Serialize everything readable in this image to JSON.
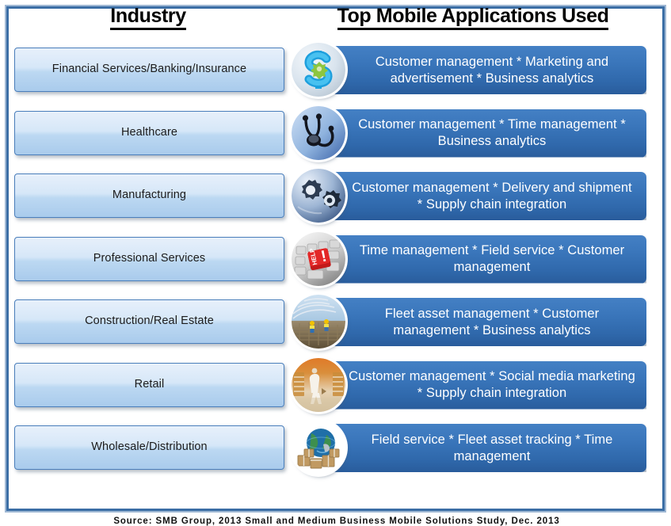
{
  "headers": {
    "industry": "Industry",
    "applications": "Top Mobile Applications Used"
  },
  "colors": {
    "frame_border": "#3b6ea5",
    "frame_outer": "#9fb8d4",
    "banner_top": "#4480c4",
    "banner_bottom": "#295c9c",
    "pill_top": "#e7f0fb",
    "pill_bottom": "#a9cbec",
    "pill_border": "#4a7ebb",
    "banner_text": "#ffffff",
    "header_text": "#000000"
  },
  "rows": [
    {
      "industry": "Financial Services/Banking/Insurance",
      "apps": "Customer management * Marketing and advertisement * Business analytics",
      "icon": "dollar-sign-icon"
    },
    {
      "industry": "Healthcare",
      "apps": "Customer management * Time management * Business analytics",
      "icon": "stethoscope-icon"
    },
    {
      "industry": "Manufacturing",
      "apps": "Customer management * Delivery and shipment * Supply chain integration",
      "icon": "gears-icon"
    },
    {
      "industry": "Professional Services",
      "apps": "Time management * Field service * Customer management",
      "icon": "keyboard-help-key-icon"
    },
    {
      "industry": "Construction/Real Estate",
      "apps": "Fleet asset management * Customer management * Business analytics",
      "icon": "construction-site-icon"
    },
    {
      "industry": "Retail",
      "apps": "Customer management * Social media marketing * Supply chain integration",
      "icon": "retail-store-icon"
    },
    {
      "industry": "Wholesale/Distribution",
      "apps": "Field service * Fleet asset tracking * Time management",
      "icon": "globe-packages-icon"
    }
  ],
  "source": "Source: SMB Group, 2013 Small and Medium Business Mobile Solutions Study, Dec. 2013"
}
